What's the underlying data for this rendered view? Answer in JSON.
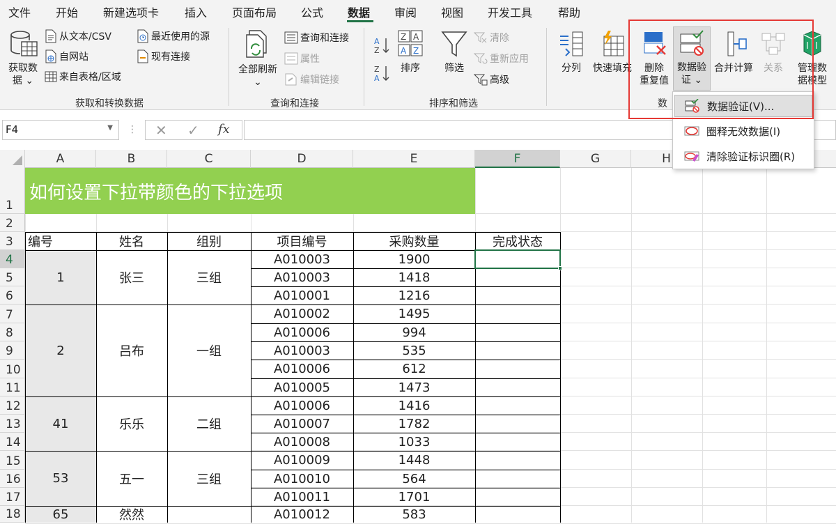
{
  "tabs": [
    "文件",
    "开始",
    "新建选项卡",
    "插入",
    "页面布局",
    "公式",
    "数据",
    "审阅",
    "视图",
    "开发工具",
    "帮助"
  ],
  "ribbon": {
    "get_data": {
      "label1": "获取数",
      "label2": "据"
    },
    "from_text": "从文本/CSV",
    "from_web": "自网站",
    "from_table": "来自表格/区域",
    "recent_sources": "最近使用的源",
    "existing_conn": "现有连接",
    "group_get": "获取和转换数据",
    "refresh_all": "全部刷新",
    "queries_conn": "查询和连接",
    "properties": "属性",
    "edit_links": "编辑链接",
    "group_query": "查询和连接",
    "sort": "排序",
    "filter": "筛选",
    "clear": "清除",
    "reapply": "重新应用",
    "advanced": "高级",
    "group_sort": "排序和筛选",
    "text_to_cols": "分列",
    "flash_fill": "快速填充",
    "remove_dup1": "删除",
    "remove_dup2": "重复值",
    "validation1": "数据验",
    "validation2": "证",
    "consolidate": "合并计算",
    "relations": "关系",
    "data_model1": "管理数",
    "data_model2": "据模型",
    "group_tools": "数"
  },
  "formula_bar": {
    "name_box": "F4",
    "fx": "fx"
  },
  "columns": [
    "A",
    "B",
    "C",
    "D",
    "E",
    "F",
    "G",
    "H"
  ],
  "rows": [
    "1",
    "2",
    "3",
    "4",
    "5",
    "6",
    "7",
    "8",
    "9",
    "10",
    "11",
    "12",
    "13",
    "14",
    "15",
    "16",
    "17",
    "18"
  ],
  "title": "如何设置下拉带颜色的下拉选项",
  "headers": [
    "编号",
    "姓名",
    "组别",
    "项目编号",
    "采购数量",
    "完成状态"
  ],
  "groups": [
    {
      "id": "1",
      "name": "张三",
      "team": "三组"
    },
    {
      "id": "2",
      "name": "吕布",
      "team": "一组"
    },
    {
      "id": "41",
      "name": "乐乐",
      "team": "二组"
    },
    {
      "id": "53",
      "name": "五一",
      "team": "三组"
    },
    {
      "id": "65",
      "name": "然然",
      "team": ""
    }
  ],
  "items": [
    {
      "code": "A010003",
      "qty": "1900"
    },
    {
      "code": "A010003",
      "qty": "1418"
    },
    {
      "code": "A010001",
      "qty": "1216"
    },
    {
      "code": "A010002",
      "qty": "1495"
    },
    {
      "code": "A010006",
      "qty": "994"
    },
    {
      "code": "A010003",
      "qty": "535"
    },
    {
      "code": "A010006",
      "qty": "612"
    },
    {
      "code": "A010005",
      "qty": "1473"
    },
    {
      "code": "A010006",
      "qty": "1416"
    },
    {
      "code": "A010007",
      "qty": "1782"
    },
    {
      "code": "A010008",
      "qty": "1033"
    },
    {
      "code": "A010009",
      "qty": "1448"
    },
    {
      "code": "A010010",
      "qty": "564"
    },
    {
      "code": "A010011",
      "qty": "1701"
    },
    {
      "code": "A010012",
      "qty": "583"
    }
  ],
  "menu": {
    "item1": "数据验证(V)...",
    "item2": "圈释无效数据(I)",
    "item3": "清除验证标识圈(R)"
  },
  "colors": {
    "title_bg": "#92d050",
    "accent": "#217346",
    "highlight_box": "#e53935"
  }
}
